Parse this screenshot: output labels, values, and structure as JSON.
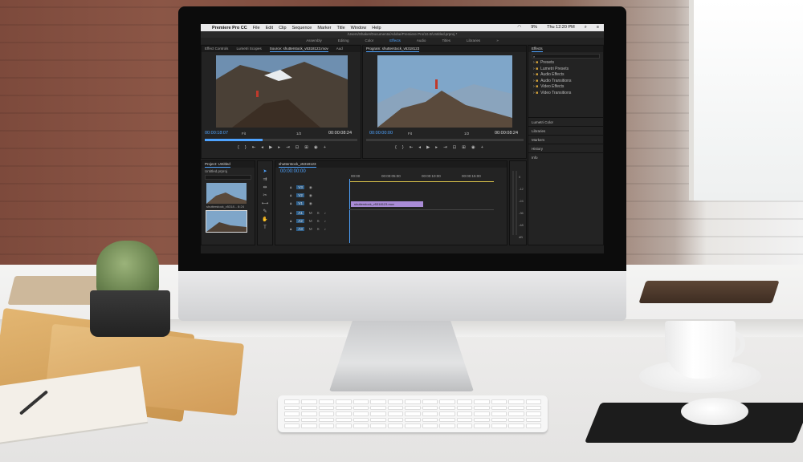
{
  "menubar": {
    "app": "Premiere Pro CC",
    "items": [
      "File",
      "Edit",
      "Clip",
      "Sequence",
      "Marker",
      "Title",
      "Window",
      "Help"
    ],
    "battery": "9%",
    "clock": "Thu 12:20 PM"
  },
  "path": "/Users/Shaker/Documents/Adobe/Premiere Pro/10.0/Untitled.prproj *",
  "workspaces": [
    "Assembly",
    "Editing",
    "Color",
    "Effects",
    "Audio",
    "Titles",
    "Libraries"
  ],
  "active_workspace": "Effects",
  "source_panel": {
    "tabs": [
      "Effect Controls",
      "Lumetri Scopes",
      "Source: shutterstock_v5318123.mov",
      "Aud"
    ],
    "timecode": "00:00:18:07",
    "fit": "Fit",
    "ratio": "1/2",
    "duration": "00:00:08:24"
  },
  "program_panel": {
    "tab": "Program: shutterstock_v5318123",
    "timecode": "00:00:00:00",
    "fit": "Fit",
    "ratio": "1/2",
    "duration": "00:00:08:24"
  },
  "effects_panel": {
    "title": "Effects",
    "folders": [
      "Presets",
      "Lumetri Presets",
      "Audio Effects",
      "Audio Transitions",
      "Video Effects",
      "Video Transitions"
    ],
    "sections": [
      "Lumetri Color",
      "Libraries",
      "Markers",
      "History",
      "Info"
    ]
  },
  "project_panel": {
    "title": "Project: Untitled",
    "file": "Untitled.prproj",
    "clip_label": "shutterstock_v5318...",
    "clip_duration": "8:24"
  },
  "timeline": {
    "tab": "shutterstock_v5318123",
    "timecode": "00:00:00:00",
    "ruler": [
      "00:00",
      "00:00:05:00",
      "00:00:10:00",
      "00:00:15:00"
    ],
    "video_tracks": [
      "V3",
      "V2",
      "V1"
    ],
    "audio_tracks": [
      "A1",
      "A2",
      "A3"
    ],
    "clip_name": "shutterstock_v5318123.mov"
  },
  "meter_scale": [
    "0",
    "-12",
    "-24",
    "-36",
    "-48",
    "dB"
  ]
}
